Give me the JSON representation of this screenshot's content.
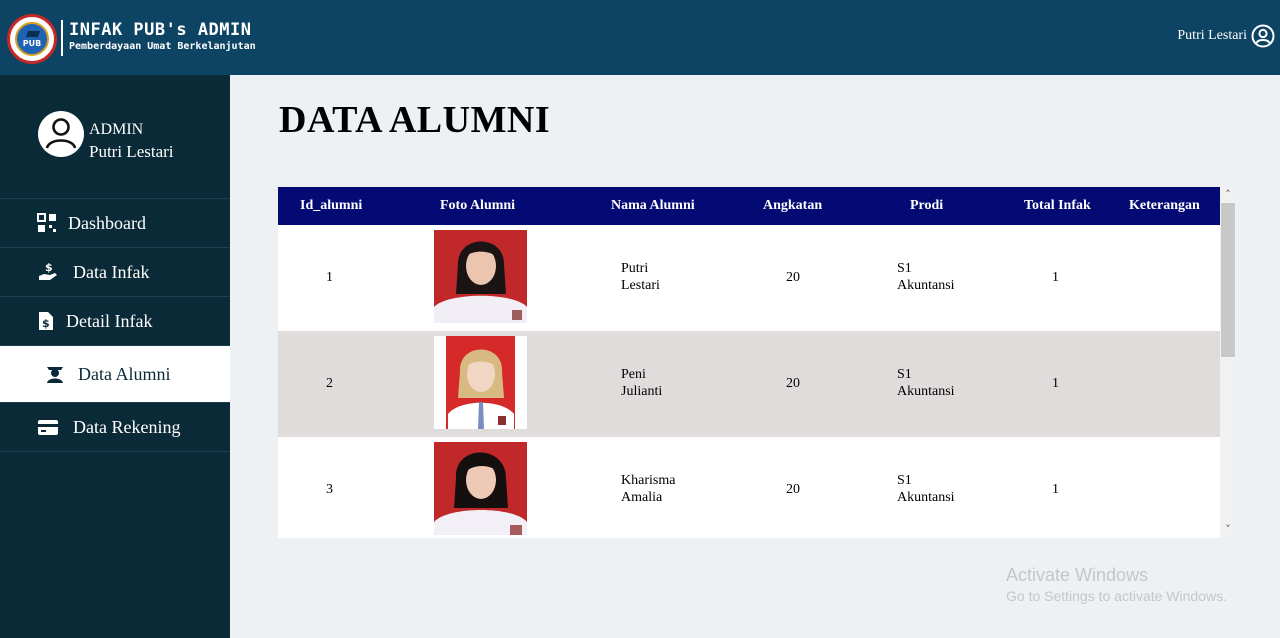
{
  "header": {
    "title": "INFAK PUB's ADMIN",
    "subtitle": "Pemberdayaan Umat Berkelanjutan",
    "logo_text": "PUB",
    "user_name": "Putri Lestari",
    "colors": {
      "bar": "#0d4363",
      "sidebar": "#0b2a38",
      "table_header": "#040a73",
      "row_alt": "#e1dcdc"
    }
  },
  "sidebar": {
    "role": "ADMIN",
    "name": "Putri Lestari",
    "items": [
      {
        "label": "Dashboard",
        "icon": "dashboard-grid-icon"
      },
      {
        "label": "Data Infak",
        "icon": "hand-money-icon"
      },
      {
        "label": "Detail Infak",
        "icon": "dollar-file-icon"
      },
      {
        "label": "Data Alumni",
        "icon": "graduate-icon",
        "active": true
      },
      {
        "label": "Data Rekening",
        "icon": "credit-card-icon"
      }
    ]
  },
  "main": {
    "title": "DATA ALUMNI",
    "columns": [
      "Id_alumni",
      "Foto Alumni",
      "Nama Alumni",
      "Angkatan",
      "Prodi",
      "Total Infak",
      "Keterangan"
    ],
    "rows": [
      {
        "id": "1",
        "name_line1": "Putri",
        "name_line2": "Lestari",
        "angkatan": "20",
        "prodi_line1": "S1",
        "prodi_line2": "Akuntansi",
        "total": "1",
        "keterangan": ""
      },
      {
        "id": "2",
        "name_line1": "Peni",
        "name_line2": "Julianti",
        "angkatan": "20",
        "prodi_line1": "S1",
        "prodi_line2": "Akuntansi",
        "total": "1",
        "keterangan": ""
      },
      {
        "id": "3",
        "name_line1": "Kharisma",
        "name_line2": "Amalia",
        "angkatan": "20",
        "prodi_line1": "S1",
        "prodi_line2": "Akuntansi",
        "total": "1",
        "keterangan": ""
      }
    ]
  },
  "watermark": {
    "line1": "Activate Windows",
    "line2": "Go to Settings to activate Windows."
  }
}
